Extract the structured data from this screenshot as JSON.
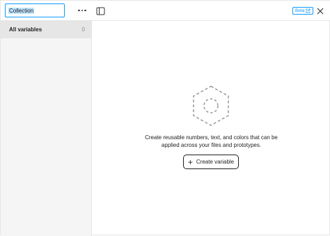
{
  "sidebar": {
    "collection_name": "Collection",
    "items": [
      {
        "label": "All variables",
        "count": "0"
      }
    ]
  },
  "toolbar": {
    "beta_label": "Beta"
  },
  "empty_state": {
    "line1": "Create reusable numbers, text, and colors that can be",
    "line2": "applied across your files and prototypes.",
    "create_button_label": "Create variable"
  },
  "icons": {
    "more": "more-horizontal-icon",
    "panel": "sidebar-toggle-icon",
    "external": "external-link-icon",
    "close": "close-icon",
    "variable": "hexagon-variable-icon",
    "plus": "plus-icon"
  },
  "colors": {
    "accent": "#0d99ff",
    "selection": "#bde3ff",
    "sidebar_bg": "#f5f5f5",
    "selected_item_bg": "#e6e6e6"
  }
}
